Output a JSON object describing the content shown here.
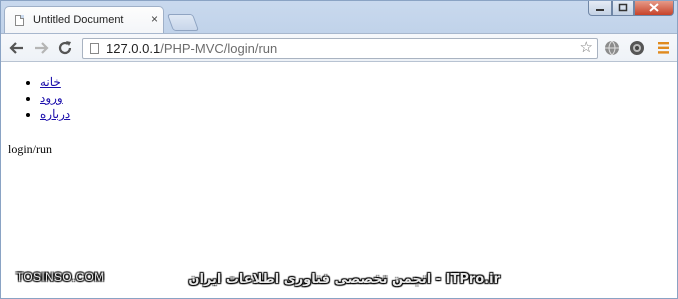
{
  "browser": {
    "tab_title": "Untitled Document",
    "tab_close": "×",
    "url_host": "127.0.0.1",
    "url_path": "/PHP-MVC/login/run",
    "icons": {
      "back": "back-arrow-icon",
      "forward": "forward-arrow-icon",
      "reload": "reload-icon",
      "bookmark": "star-icon",
      "menu": "hamburger-menu-icon"
    }
  },
  "page": {
    "nav_items": [
      "خانه",
      "ورود",
      "درباره"
    ],
    "route_text": "login/run"
  },
  "watermarks": {
    "left": "TOSINSO.COM",
    "center": "ITPro.ir - انجمن تخصصی فناوری اطلاعات ایران"
  }
}
